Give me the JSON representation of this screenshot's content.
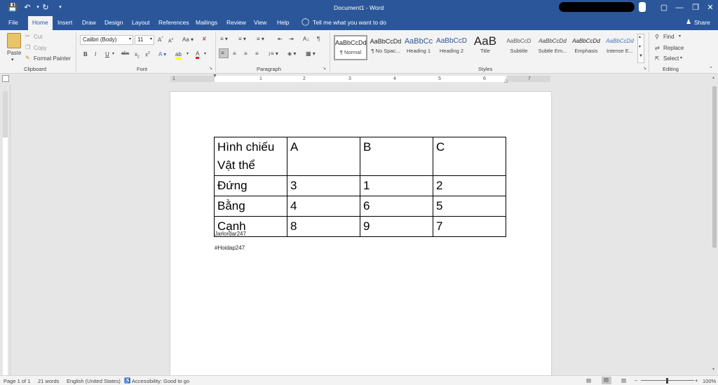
{
  "titlebar": {
    "title": "Document1 - Word",
    "window_controls": [
      "minimize-icon",
      "restore-icon",
      "close-icon"
    ]
  },
  "tabs": [
    {
      "label": "File"
    },
    {
      "label": "Home"
    },
    {
      "label": "Insert"
    },
    {
      "label": "Draw"
    },
    {
      "label": "Design"
    },
    {
      "label": "Layout"
    },
    {
      "label": "References"
    },
    {
      "label": "Mailings"
    },
    {
      "label": "Review"
    },
    {
      "label": "View"
    },
    {
      "label": "Help"
    }
  ],
  "tell_me": "Tell me what you want to do",
  "share": "Share",
  "clipboard": {
    "paste": "Paste",
    "cut": "Cut",
    "copy": "Copy",
    "format_painter": "Format Painter",
    "group_label": "Clipboard"
  },
  "font": {
    "name": "Calibri (Body)",
    "size": "11",
    "group_label": "Font",
    "bold": "B",
    "italic": "I",
    "underline": "U"
  },
  "paragraph": {
    "group_label": "Paragraph"
  },
  "styles": {
    "group_label": "Styles",
    "items": [
      {
        "preview": "AaBbCcDd",
        "name": "¶ Normal"
      },
      {
        "preview": "AaBbCcDd",
        "name": "¶ No Spac..."
      },
      {
        "preview": "AaBbCc",
        "name": "Heading 1"
      },
      {
        "preview": "AaBbCcD",
        "name": "Heading 2"
      },
      {
        "preview": "AaB",
        "name": "Title"
      },
      {
        "preview": "AaBbCcD",
        "name": "Subtitle"
      },
      {
        "preview": "AaBbCcDd",
        "name": "Subtle Em..."
      },
      {
        "preview": "AaBbCcDd",
        "name": "Emphasis"
      },
      {
        "preview": "AaBbCcDd",
        "name": "Intense E..."
      }
    ]
  },
  "editing": {
    "find": "Find",
    "replace": "Replace",
    "select": "Select",
    "group_label": "Editing"
  },
  "ruler": {
    "ticks": [
      "1",
      "1",
      "2",
      "3",
      "4",
      "5",
      "6",
      "7"
    ]
  },
  "document": {
    "table": {
      "rows": [
        [
          "Hình chiếu\nVật thể",
          "A",
          "B",
          "C"
        ],
        [
          "Đứng",
          "3",
          "1",
          "2"
        ],
        [
          "Bằng",
          "4",
          "6",
          "5"
        ],
        [
          "Cạnh",
          "8",
          "9",
          "7"
        ]
      ]
    },
    "paragraphs": [
      "Jarlordar247",
      "#Hoidap247"
    ]
  },
  "status": {
    "page": "Page 1 of 1",
    "words": "21 words",
    "language": "English (United States)",
    "accessibility": "Accessibility: Good to go",
    "zoom": "100%"
  },
  "colors": {
    "word_blue": "#2b579a",
    "ribbon_bg": "#f3f3f3",
    "canvas_bg": "#e6e6e6"
  }
}
